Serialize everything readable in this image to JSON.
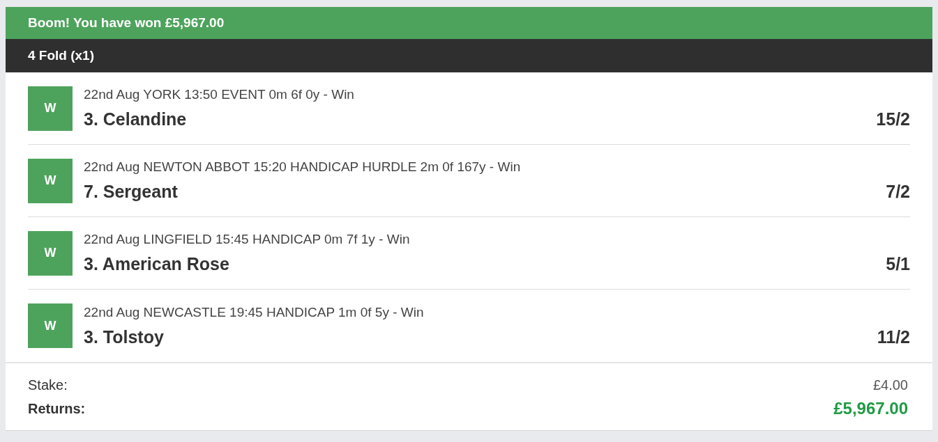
{
  "banner": {
    "message": "Boom! You have won £5,967.00"
  },
  "bet_type": "4 Fold (x1)",
  "selections": [
    {
      "result": "W",
      "event": "22nd Aug YORK 13:50 EVENT 0m 6f 0y - Win",
      "runner": "3. Celandine",
      "odds": "15/2"
    },
    {
      "result": "W",
      "event": "22nd Aug NEWTON ABBOT 15:20 HANDICAP HURDLE 2m 0f 167y - Win",
      "runner": "7. Sergeant",
      "odds": "7/2"
    },
    {
      "result": "W",
      "event": "22nd Aug LINGFIELD 15:45 HANDICAP 0m 7f 1y - Win",
      "runner": "3. American Rose",
      "odds": "5/1"
    },
    {
      "result": "W",
      "event": "22nd Aug NEWCASTLE 19:45 HANDICAP 1m 0f 5y - Win",
      "runner": "3. Tolstoy",
      "odds": "11/2"
    }
  ],
  "summary": {
    "stake_label": "Stake:",
    "stake": "£4.00",
    "returns_label": "Returns:",
    "returns": "£5,967.00"
  }
}
